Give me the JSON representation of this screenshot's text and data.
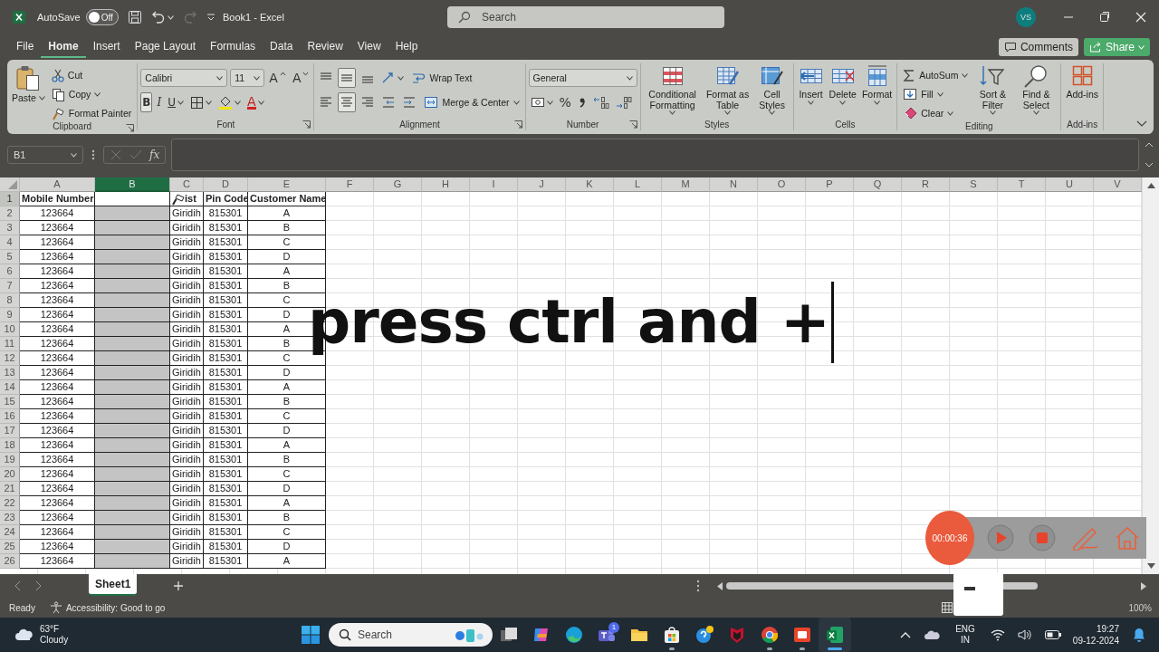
{
  "window": {
    "autosave": {
      "label": "AutoSave",
      "on": false,
      "state_text": "Off"
    },
    "quick_access": [
      {
        "kind": "save",
        "disabled": false
      },
      {
        "kind": "undo",
        "disabled": false
      },
      {
        "kind": "redo",
        "disabled": true
      },
      {
        "kind": "customize",
        "disabled": false
      }
    ],
    "title": "Book1  -  Excel",
    "search_placeholder": "Search",
    "user_initials": "VS"
  },
  "menu_tabs": [
    {
      "label": "File",
      "selected": false
    },
    {
      "label": "Home",
      "selected": true
    },
    {
      "label": "Insert",
      "selected": false
    },
    {
      "label": "Page Layout",
      "selected": false
    },
    {
      "label": "Formulas",
      "selected": false
    },
    {
      "label": "Data",
      "selected": false
    },
    {
      "label": "Review",
      "selected": false
    },
    {
      "label": "View",
      "selected": false
    },
    {
      "label": "Help",
      "selected": false
    }
  ],
  "comments_button": "Comments",
  "share_button": "Share",
  "ribbon": [
    {
      "label": "Clipboard",
      "launcher": true,
      "items": [
        {
          "kind": "paste",
          "label": "Paste",
          "dropdown": true
        },
        {
          "kind": "cut",
          "label": "Cut",
          "dropdown": false
        },
        {
          "kind": "copy",
          "label": "Copy",
          "dropdown": true
        },
        {
          "kind": "format-painter",
          "label": "Format Painter",
          "dropdown": false
        }
      ]
    },
    {
      "label": "Font",
      "launcher": true,
      "upper_tools": [
        {
          "kind": "font-name",
          "value": "Calibri",
          "dropdown": true,
          "selected": false
        },
        {
          "kind": "font-size",
          "value": "11",
          "dropdown": true,
          "selected": false
        },
        {
          "kind": "grow-font",
          "label": "A",
          "dropdown": false,
          "selected": false
        },
        {
          "kind": "shrink-font",
          "label": "A",
          "dropdown": false,
          "selected": false
        }
      ],
      "lower_tools": [
        {
          "kind": "bold",
          "label": "B",
          "dropdown": false,
          "selected": true
        },
        {
          "kind": "italic",
          "label": "I",
          "dropdown": false,
          "selected": false
        },
        {
          "kind": "underline",
          "label": "U",
          "dropdown": true,
          "selected": false
        },
        {
          "kind": "borders",
          "dropdown": true,
          "selected": false
        },
        {
          "kind": "fill-color",
          "dropdown": true,
          "selected": false
        },
        {
          "kind": "font-color",
          "label": "A",
          "dropdown": true,
          "selected": false
        }
      ]
    },
    {
      "label": "Alignment",
      "launcher": true,
      "upper_tools": [
        {
          "kind": "align-top",
          "dropdown": false,
          "selected": false
        },
        {
          "kind": "align-middle",
          "dropdown": false,
          "selected": true
        },
        {
          "kind": "align-bottom",
          "dropdown": false,
          "selected": false
        },
        {
          "kind": "orientation",
          "dropdown": true,
          "selected": false
        },
        {
          "kind": "wrap-text",
          "label": "Wrap Text",
          "dropdown": false,
          "selected": false
        }
      ],
      "lower_tools": [
        {
          "kind": "align-left",
          "dropdown": false,
          "selected": false
        },
        {
          "kind": "align-center",
          "dropdown": false,
          "selected": true
        },
        {
          "kind": "align-right",
          "dropdown": false,
          "selected": false
        },
        {
          "kind": "outdent",
          "dropdown": false,
          "selected": false
        },
        {
          "kind": "indent",
          "dropdown": false,
          "selected": false
        },
        {
          "kind": "merge-center",
          "label": "Merge & Center",
          "dropdown": true,
          "selected": false
        }
      ]
    },
    {
      "label": "Number",
      "launcher": true,
      "upper_tools": [
        {
          "kind": "number-format",
          "value": "General",
          "dropdown": true,
          "selected": false
        }
      ],
      "lower_tools": [
        {
          "kind": "accounting",
          "dropdown": true,
          "selected": false
        },
        {
          "kind": "percent",
          "label": "%",
          "dropdown": false,
          "selected": false
        },
        {
          "kind": "comma",
          "dropdown": false,
          "selected": false
        },
        {
          "kind": "increase-decimal",
          "dropdown": false,
          "selected": false
        },
        {
          "kind": "decrease-decimal",
          "dropdown": false,
          "selected": false
        }
      ]
    },
    {
      "label": "Styles",
      "launcher": false,
      "items": [
        {
          "kind": "conditional-formatting",
          "label": "Conditional Formatting",
          "dropdown": true
        },
        {
          "kind": "format-as-table",
          "label": "Format as Table",
          "dropdown": true
        },
        {
          "kind": "cell-styles",
          "label": "Cell Styles",
          "dropdown": true
        }
      ]
    },
    {
      "label": "Cells",
      "launcher": false,
      "items": [
        {
          "kind": "insert",
          "label": "Insert",
          "dropdown": true
        },
        {
          "kind": "delete",
          "label": "Delete",
          "dropdown": true
        },
        {
          "kind": "format",
          "label": "Format",
          "dropdown": true
        }
      ]
    },
    {
      "label": "Editing",
      "launcher": false,
      "items": [
        {
          "kind": "autosum",
          "label": "AutoSum",
          "dropdown": true
        },
        {
          "kind": "fill",
          "label": "Fill",
          "dropdown": true
        },
        {
          "kind": "clear",
          "label": "Clear",
          "dropdown": true
        },
        {
          "kind": "sort-filter",
          "label": "Sort & Filter",
          "dropdown": true
        },
        {
          "kind": "find-select",
          "label": "Find & Select",
          "dropdown": true
        }
      ]
    },
    {
      "label": "Add-ins",
      "launcher": false,
      "items": [
        {
          "kind": "add-ins",
          "label": "Add-ins",
          "dropdown": false
        }
      ]
    }
  ],
  "formula_bar": {
    "name_box": "B1",
    "function_label": "fx"
  },
  "sheet": {
    "columns": [
      {
        "label": "A",
        "selected": false
      },
      {
        "label": "B",
        "selected": true
      },
      {
        "label": "C",
        "selected": false
      },
      {
        "label": "D",
        "selected": false
      },
      {
        "label": "E",
        "selected": false
      },
      {
        "label": "F",
        "selected": false
      },
      {
        "label": "G",
        "selected": false
      },
      {
        "label": "H",
        "selected": false
      },
      {
        "label": "I",
        "selected": false
      },
      {
        "label": "J",
        "selected": false
      },
      {
        "label": "K",
        "selected": false
      },
      {
        "label": "L",
        "selected": false
      },
      {
        "label": "M",
        "selected": false
      },
      {
        "label": "N",
        "selected": false
      },
      {
        "label": "O",
        "selected": false
      },
      {
        "label": "P",
        "selected": false
      },
      {
        "label": "Q",
        "selected": false
      },
      {
        "label": "R",
        "selected": false
      },
      {
        "label": "S",
        "selected": false
      },
      {
        "label": "T",
        "selected": false
      },
      {
        "label": "U",
        "selected": false
      },
      {
        "label": "V",
        "selected": false
      }
    ],
    "rows": [
      {
        "label": "1",
        "kind": "header",
        "active": true,
        "cells": [
          "Mobile Number",
          null,
          "ist",
          "Pin Code",
          "Customer Name"
        ]
      },
      {
        "label": "2",
        "kind": "data",
        "active": false,
        "cells": [
          "123664",
          null,
          "Giridih",
          "815301",
          "A"
        ]
      },
      {
        "label": "3",
        "kind": "data",
        "active": false,
        "cells": [
          "123664",
          null,
          "Giridih",
          "815301",
          "B"
        ]
      },
      {
        "label": "4",
        "kind": "data",
        "active": false,
        "cells": [
          "123664",
          null,
          "Giridih",
          "815301",
          "C"
        ]
      },
      {
        "label": "5",
        "kind": "data",
        "active": false,
        "cells": [
          "123664",
          null,
          "Giridih",
          "815301",
          "D"
        ]
      },
      {
        "label": "6",
        "kind": "data",
        "active": false,
        "cells": [
          "123664",
          null,
          "Giridih",
          "815301",
          "A"
        ]
      },
      {
        "label": "7",
        "kind": "data",
        "active": false,
        "cells": [
          "123664",
          null,
          "Giridih",
          "815301",
          "B"
        ]
      },
      {
        "label": "8",
        "kind": "data",
        "active": false,
        "cells": [
          "123664",
          null,
          "Giridih",
          "815301",
          "C"
        ]
      },
      {
        "label": "9",
        "kind": "data",
        "active": false,
        "cells": [
          "123664",
          null,
          "Giridih",
          "815301",
          "D"
        ]
      },
      {
        "label": "10",
        "kind": "data",
        "active": false,
        "cells": [
          "123664",
          null,
          "Giridih",
          "815301",
          "A"
        ]
      },
      {
        "label": "11",
        "kind": "data",
        "active": false,
        "cells": [
          "123664",
          null,
          "Giridih",
          "815301",
          "B"
        ]
      },
      {
        "label": "12",
        "kind": "data",
        "active": false,
        "cells": [
          "123664",
          null,
          "Giridih",
          "815301",
          "C"
        ]
      },
      {
        "label": "13",
        "kind": "data",
        "active": false,
        "cells": [
          "123664",
          null,
          "Giridih",
          "815301",
          "D"
        ]
      },
      {
        "label": "14",
        "kind": "data",
        "active": false,
        "cells": [
          "123664",
          null,
          "Giridih",
          "815301",
          "A"
        ]
      },
      {
        "label": "15",
        "kind": "data",
        "active": false,
        "cells": [
          "123664",
          null,
          "Giridih",
          "815301",
          "B"
        ]
      },
      {
        "label": "16",
        "kind": "data",
        "active": false,
        "cells": [
          "123664",
          null,
          "Giridih",
          "815301",
          "C"
        ]
      },
      {
        "label": "17",
        "kind": "data",
        "active": false,
        "cells": [
          "123664",
          null,
          "Giridih",
          "815301",
          "D"
        ]
      },
      {
        "label": "18",
        "kind": "data",
        "active": false,
        "cells": [
          "123664",
          null,
          "Giridih",
          "815301",
          "A"
        ]
      },
      {
        "label": "19",
        "kind": "data",
        "active": false,
        "cells": [
          "123664",
          null,
          "Giridih",
          "815301",
          "B"
        ]
      },
      {
        "label": "20",
        "kind": "data",
        "active": false,
        "cells": [
          "123664",
          null,
          "Giridih",
          "815301",
          "C"
        ]
      },
      {
        "label": "21",
        "kind": "data",
        "active": false,
        "cells": [
          "123664",
          null,
          "Giridih",
          "815301",
          "D"
        ]
      },
      {
        "label": "22",
        "kind": "data",
        "active": false,
        "cells": [
          "123664",
          null,
          "Giridih",
          "815301",
          "A"
        ]
      },
      {
        "label": "23",
        "kind": "data",
        "active": false,
        "cells": [
          "123664",
          null,
          "Giridih",
          "815301",
          "B"
        ]
      },
      {
        "label": "24",
        "kind": "data",
        "active": false,
        "cells": [
          "123664",
          null,
          "Giridih",
          "815301",
          "C"
        ]
      },
      {
        "label": "25",
        "kind": "data",
        "active": false,
        "cells": [
          "123664",
          null,
          "Giridih",
          "815301",
          "D"
        ]
      },
      {
        "label": "26",
        "kind": "data",
        "active": false,
        "cells": [
          "123664",
          null,
          "Giridih",
          "815301",
          "A"
        ]
      }
    ]
  },
  "caption": "press ctrl and +",
  "recorder": {
    "timer": "00:00:36"
  },
  "sheet_tabs": [
    {
      "label": "Sheet1",
      "selected": true
    }
  ],
  "status_bar": {
    "mode": "Ready",
    "accessibility": "Accessibility: Good to go",
    "zoom": "100%"
  },
  "taskbar": {
    "weather": {
      "temperature": "63°F",
      "condition": "Cloudy"
    },
    "search_placeholder": "Search",
    "apps": [
      {
        "kind": "task-view",
        "running": false,
        "selected": false
      },
      {
        "kind": "copilot",
        "running": false,
        "selected": false
      },
      {
        "kind": "edge",
        "running": false,
        "selected": false
      },
      {
        "kind": "teams",
        "badge": "1",
        "running": false,
        "selected": false
      },
      {
        "kind": "explorer",
        "running": false,
        "selected": false
      },
      {
        "kind": "store",
        "running": true,
        "selected": false
      },
      {
        "kind": "help",
        "running": false,
        "selected": false
      },
      {
        "kind": "mcafee",
        "running": false,
        "selected": false
      },
      {
        "kind": "chrome",
        "running": true,
        "selected": false
      },
      {
        "kind": "recorder",
        "running": true,
        "selected": false
      },
      {
        "kind": "excel",
        "running": true,
        "selected": true
      }
    ],
    "tray": {
      "language": "ENG",
      "region": "IN",
      "time": "19:27",
      "date": "09-12-2024"
    }
  }
}
